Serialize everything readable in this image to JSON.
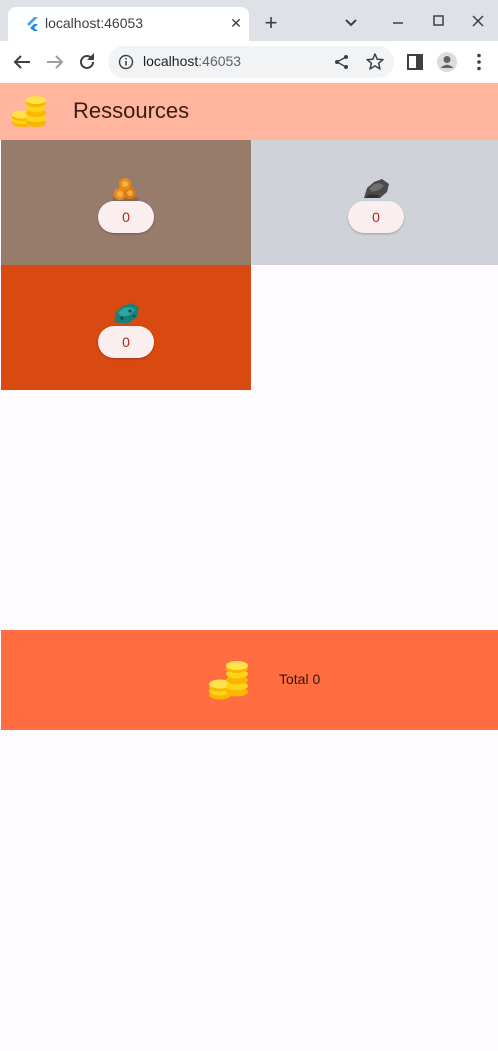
{
  "browser": {
    "tab_title": "localhost:46053",
    "tab_close": "✕",
    "new_tab": "+",
    "url_host": "localhost",
    "url_port": ":46053"
  },
  "app": {
    "title": "Ressources",
    "tiles": [
      {
        "name": "wood",
        "icon": "wood-logs-icon",
        "count": "0",
        "color": "#977b6b"
      },
      {
        "name": "stone",
        "icon": "stone-icon",
        "count": "0",
        "color": "#cfd3d9"
      },
      {
        "name": "ore",
        "icon": "teal-ore-icon",
        "count": "0",
        "color": "#d94a10"
      }
    ],
    "total_label": "Total 0",
    "colors": {
      "appbar": "#ffb59e",
      "total_bar": "#ff6d40",
      "pill_text": "#b3261e"
    }
  }
}
